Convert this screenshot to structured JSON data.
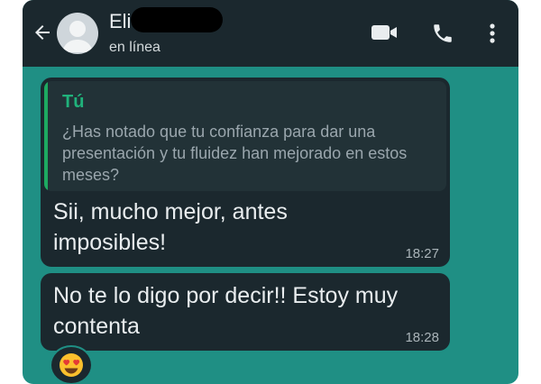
{
  "header": {
    "contact_name": "Eli",
    "status": "en línea",
    "icons": {
      "back": "arrow-left-icon",
      "avatar": "person-icon",
      "video": "video-camera-icon",
      "call": "phone-icon",
      "menu": "more-vert-icon"
    }
  },
  "messages": [
    {
      "quoted": {
        "author": "Tú",
        "text": "¿Has notado que tu confianza para dar una presentación y tu fluidez han mejorado en estos meses?"
      },
      "text": "Sii, mucho mejor, antes imposibles!",
      "time": "18:27"
    },
    {
      "text": "No te lo digo por decir!! Estoy muy contenta",
      "time": "18:28",
      "reaction": "heart-eyes-emoji"
    }
  ],
  "colors": {
    "chat_background": "#1f8f84",
    "bubble": "#1b282e",
    "quote_accent": "#1daa61",
    "quote_author": "#20b27b"
  }
}
